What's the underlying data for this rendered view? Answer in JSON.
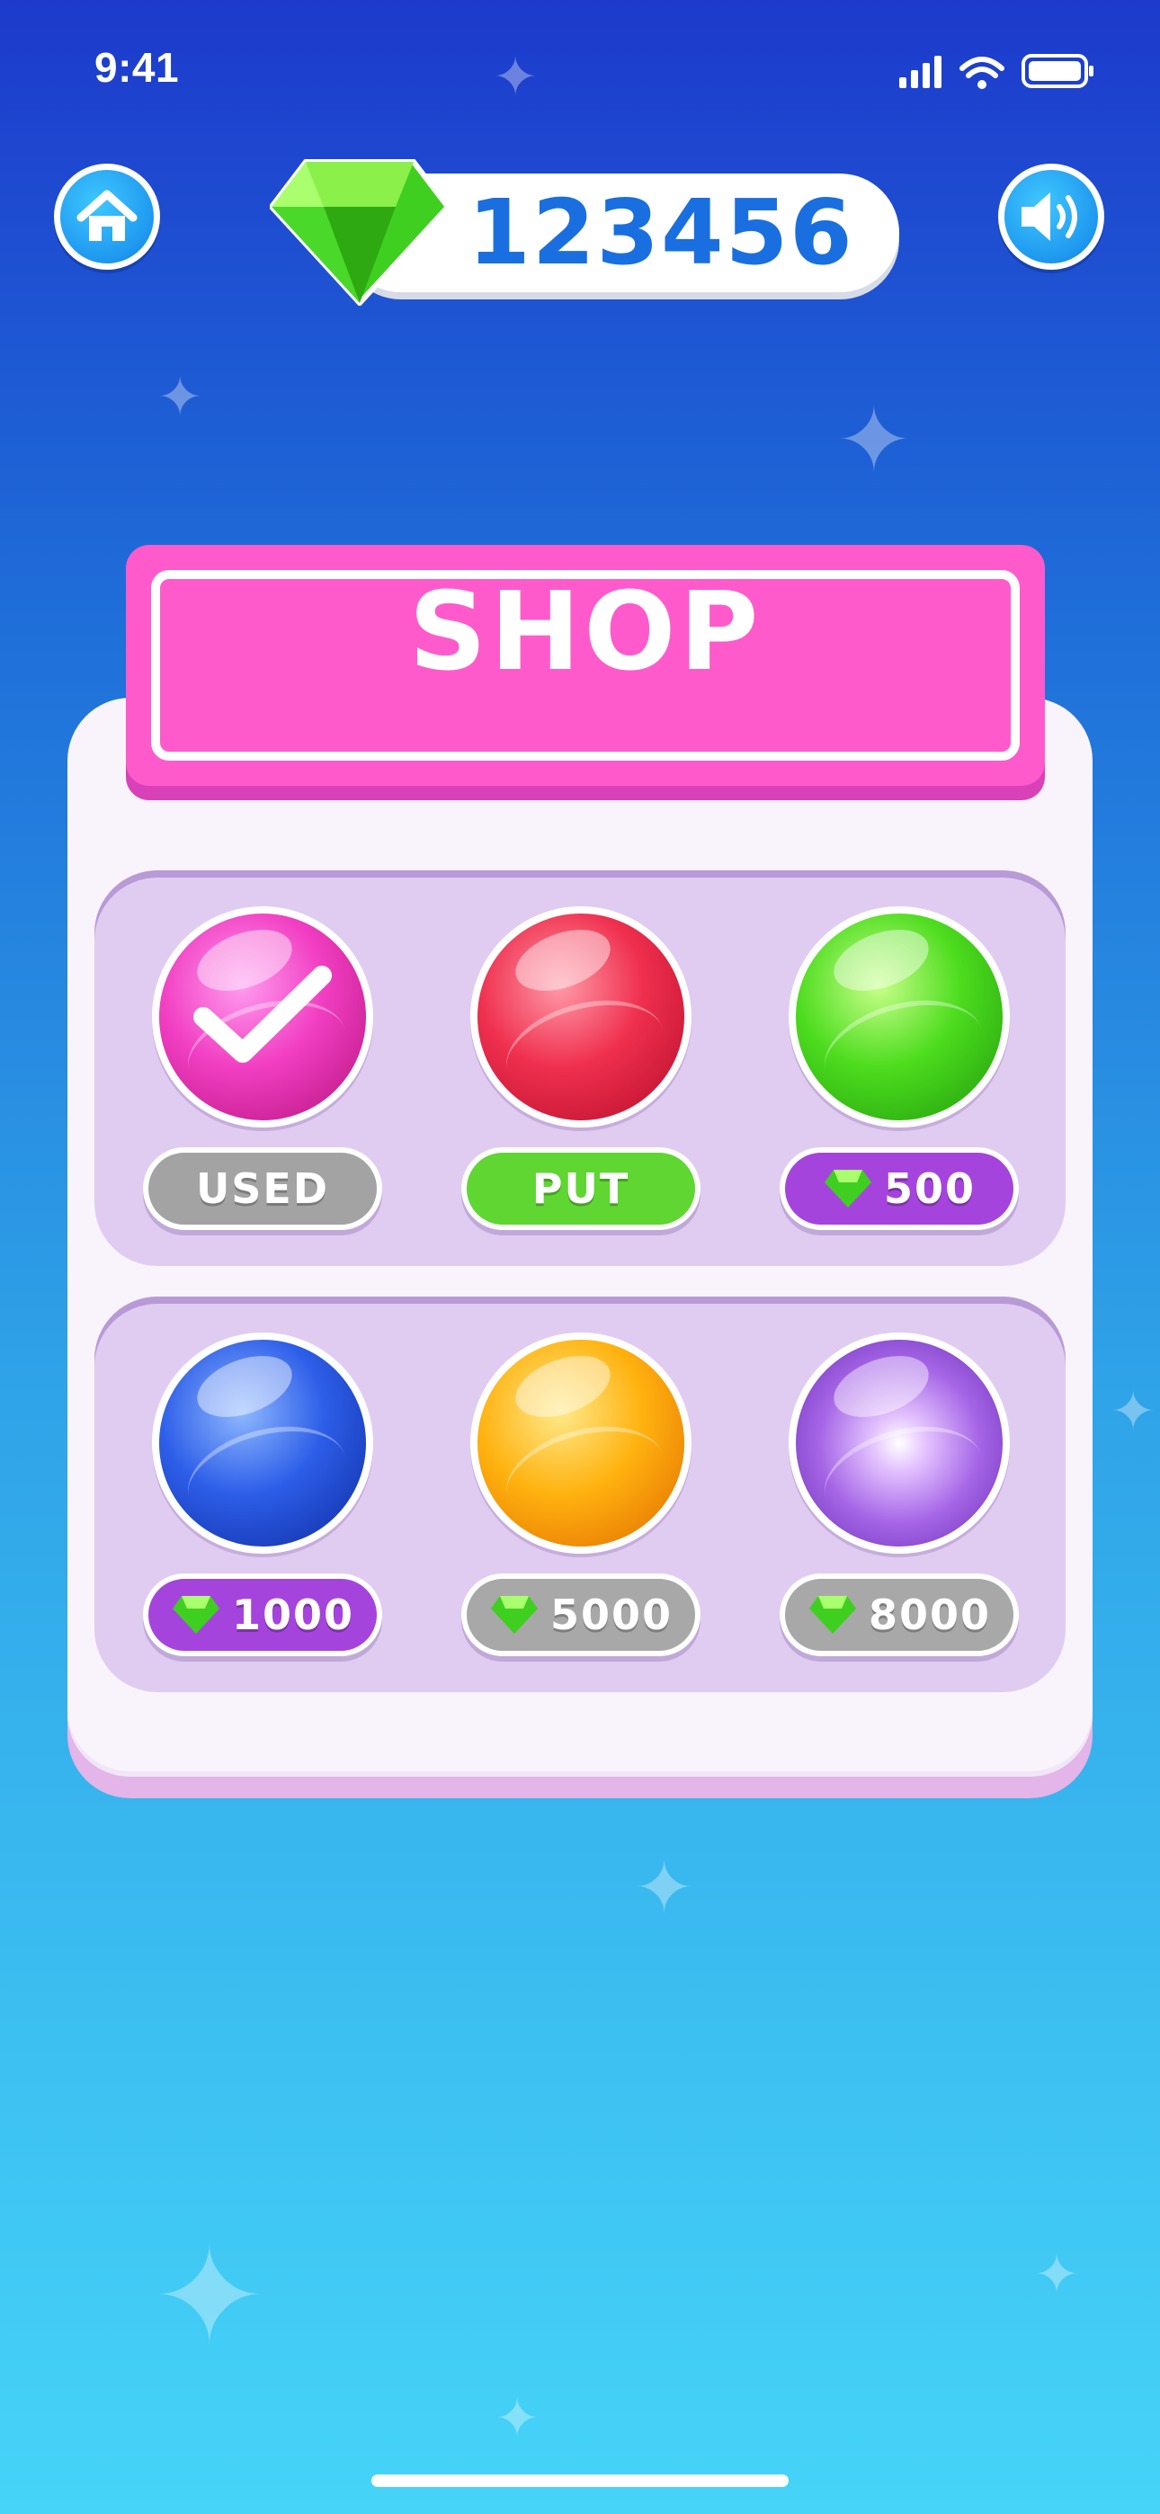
{
  "status_bar": {
    "time": "9:41"
  },
  "hud": {
    "gem_count": "123456",
    "home_icon": "home-icon",
    "sound_icon": "speaker-icon"
  },
  "shop": {
    "title": "SHOP",
    "items": [
      {
        "color": "pink",
        "state": "USED",
        "label": "USED"
      },
      {
        "color": "red",
        "state": "PUT",
        "label": "PUT"
      },
      {
        "color": "green",
        "state": "buy",
        "label": "500"
      },
      {
        "color": "blue",
        "state": "buy",
        "label": "1000"
      },
      {
        "color": "orange",
        "state": "locked",
        "label": "5000"
      },
      {
        "color": "purple",
        "state": "locked",
        "label": "8000"
      }
    ]
  },
  "colors": {
    "banner": "#ff5acb",
    "panel": "#f9f4fc",
    "row_card": "#e0ccf1",
    "used_pill": "#a3a3a3",
    "put_pill": "#5fd632",
    "buy_pill": "#a544dd",
    "gem_count_text": "#1a6fe0"
  }
}
